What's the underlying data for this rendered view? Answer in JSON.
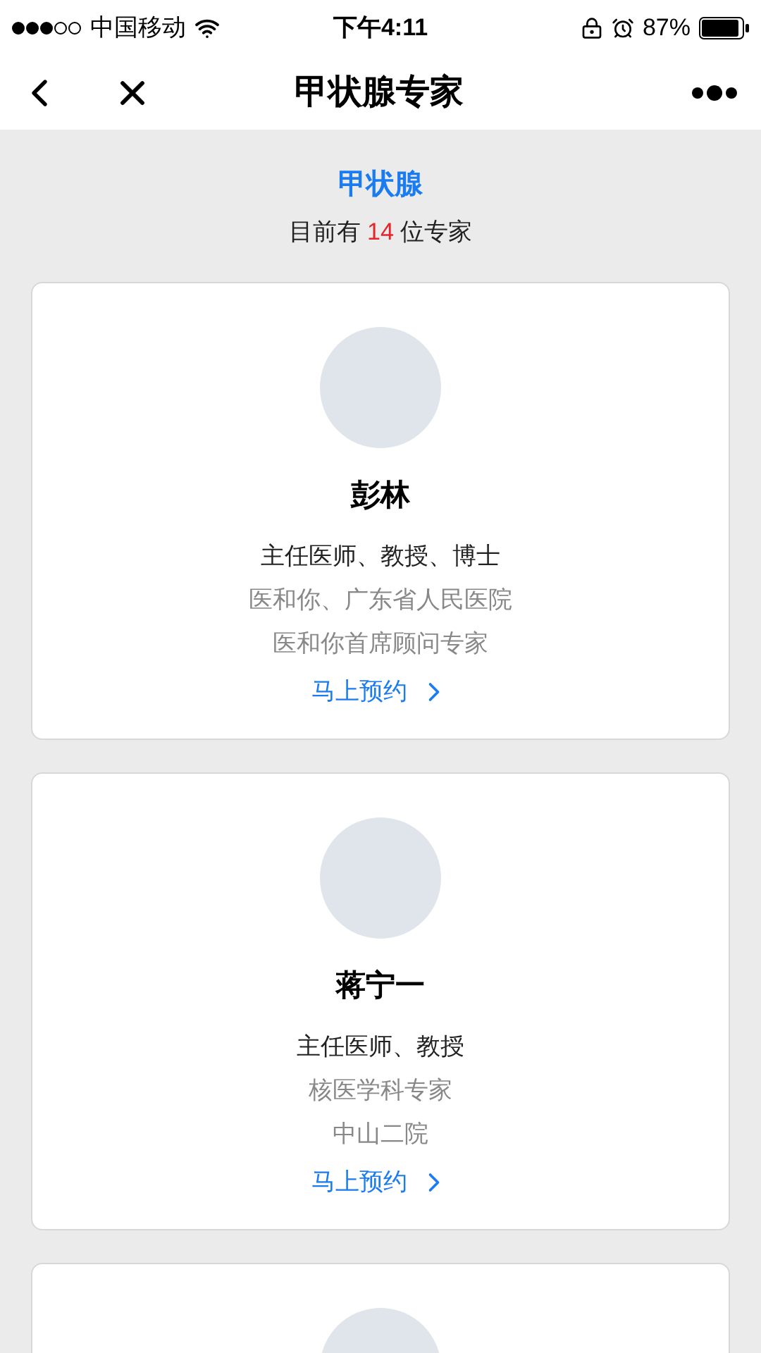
{
  "status_bar": {
    "carrier": "中国移动",
    "time": "下午4:11",
    "battery": "87%"
  },
  "nav": {
    "title": "甲状腺专家"
  },
  "header": {
    "category": "甲状腺",
    "count_prefix": "目前有",
    "count": "14",
    "count_suffix": "位专家"
  },
  "doctors": [
    {
      "name": "彭林",
      "title": "主任医师、教授、博士",
      "details": [
        "医和你、广东省人民医院",
        "医和你首席顾问专家"
      ],
      "action": "马上预约"
    },
    {
      "name": "蒋宁一",
      "title": "主任医师、教授",
      "details": [
        "核医学科专家",
        "中山二院"
      ],
      "action": "马上预约"
    }
  ],
  "more_below": true
}
